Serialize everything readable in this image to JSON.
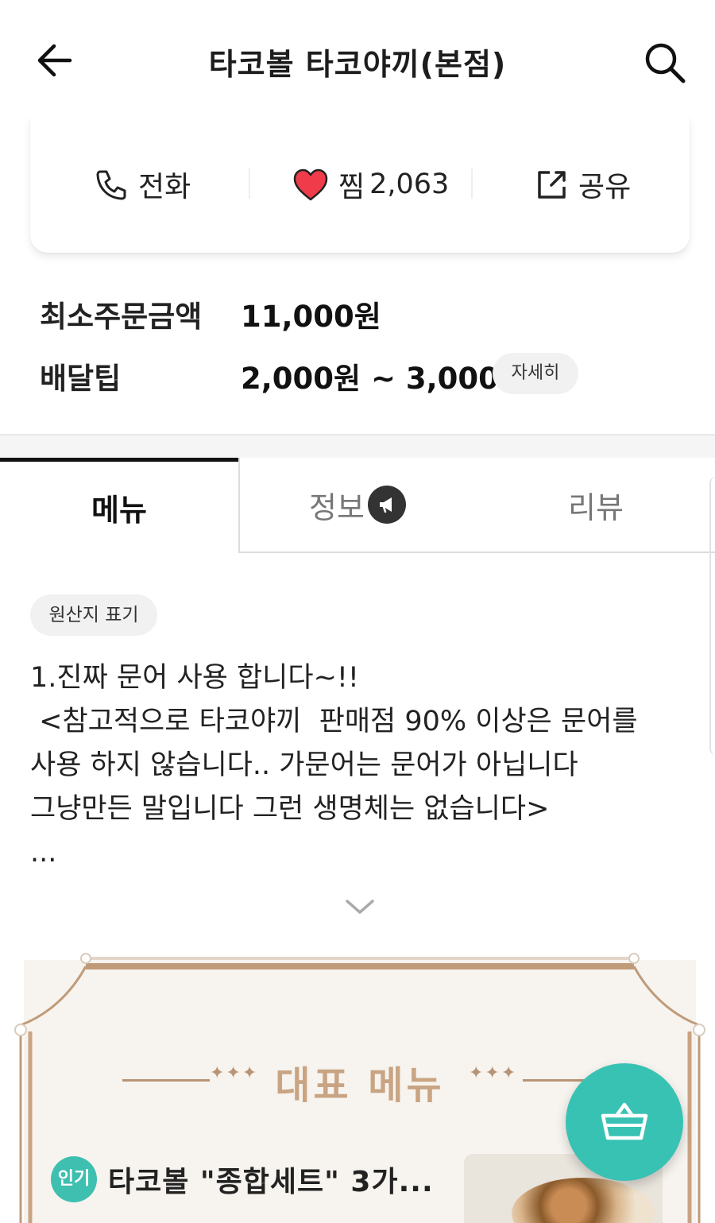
{
  "appbar": {
    "title": "타코볼 타코야끼(본점)",
    "back_icon": "arrow-left-icon",
    "search_icon": "search-icon"
  },
  "actions": {
    "call_label": "전화",
    "like_label": "찜",
    "like_count": "2,063",
    "share_label": "공유",
    "like_color": "#ef3b4a"
  },
  "order_info": {
    "min_order_label": "최소주문금액",
    "min_order_value": "11,000원",
    "delivery_tip_label": "배달팁",
    "delivery_tip_value": "2,000원 ~ 3,000원",
    "detail_button": "자세히"
  },
  "tabs": [
    {
      "label": "메뉴",
      "active": true
    },
    {
      "label": "정보",
      "active": false,
      "icon": "megaphone-icon"
    },
    {
      "label": "리뷰",
      "active": false
    }
  ],
  "notice": {
    "chip": "원산지 표기",
    "text": "1.진짜 문어 사용 합니다~!!\n <참고적으로 타코야끼  판매점 90% 이상은 문어를\n사용 하지 않습니다.. 가문어는 문어가 아닙니다\n그냥만든 말입니다 그런 생명체는 없습니다>\n...",
    "expand_icon": "chevron-down-icon"
  },
  "banner": {
    "title": "대표 메뉴",
    "ornament": "✦✦✦",
    "accent": "#c9a483"
  },
  "featured_item": {
    "badge": "인기",
    "title": "타코볼 \"종합세트\" 3가...",
    "badge_color": "#3fbfb0"
  },
  "cart": {
    "icon": "basket-icon",
    "color": "#38c2b4"
  }
}
